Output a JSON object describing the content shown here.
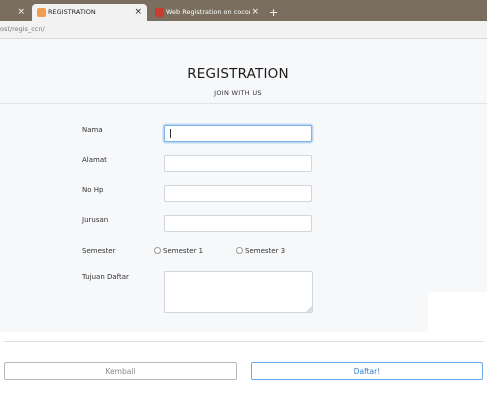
{
  "browser": {
    "tabs": [
      {
        "title": "",
        "favicon_color": "#f29c52"
      },
      {
        "title": "REGISTRATION",
        "favicon_color": "#f29c52"
      },
      {
        "title": "Web Registration on coconut.or.i",
        "favicon_color": "#cc3b2f"
      }
    ],
    "new_tab_label": "+",
    "close_glyph": "×",
    "url": "ost/regis_ccn/"
  },
  "form": {
    "title": "REGISTRATION",
    "subtitle": "JOIN WITH US",
    "fields": {
      "nama": {
        "label": "Nama",
        "value": ""
      },
      "alamat": {
        "label": "Alamat",
        "value": ""
      },
      "nohp": {
        "label": "No Hp",
        "value": ""
      },
      "jurusan": {
        "label": "Jurusan",
        "value": ""
      },
      "tujuan": {
        "label": "Tujuan Daftar",
        "value": ""
      }
    },
    "semester": {
      "label": "Semester",
      "options": [
        "Semester 1",
        "Semester 3"
      ]
    },
    "buttons": {
      "back": "Kembali",
      "submit": "Daftar!"
    }
  },
  "colors": {
    "tab_bar": "#7a6e5f",
    "accent": "#2f7fd1",
    "focus_ring": "#7fb2e5"
  }
}
